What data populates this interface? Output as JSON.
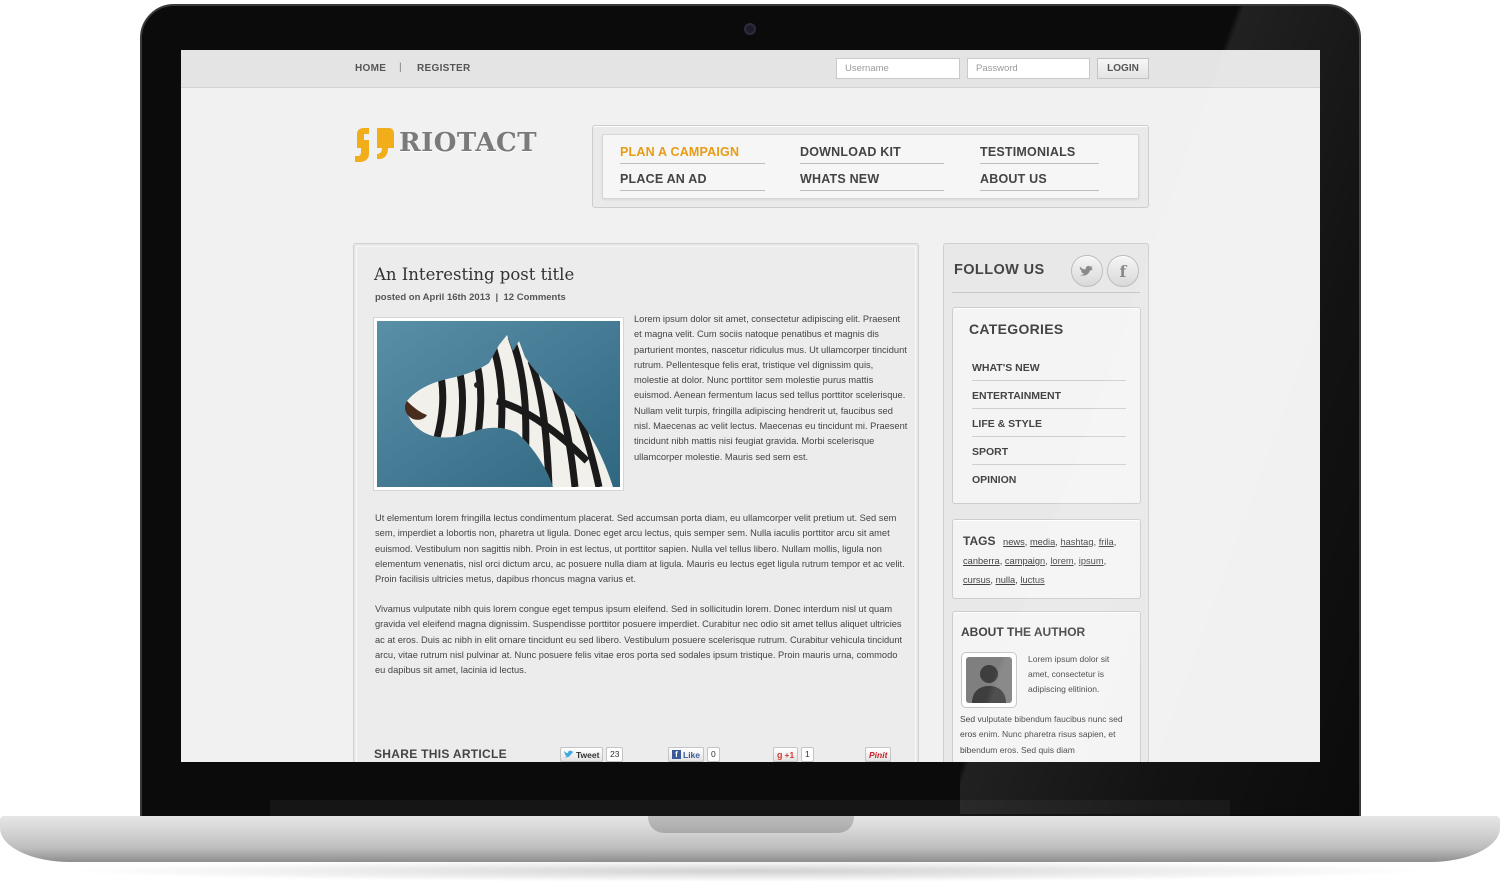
{
  "topbar": {
    "home": "HOME",
    "separator": "|",
    "register": "REGISTER",
    "username_placeholder": "Username",
    "password_placeholder": "Password",
    "login": "LOGIN"
  },
  "brand": {
    "name": "RIOTACT",
    "accent_color": "#f2ae1a"
  },
  "nav": {
    "items": [
      {
        "label": "PLAN A CAMPAIGN",
        "active": true
      },
      {
        "label": "DOWNLOAD KIT"
      },
      {
        "label": "TESTIMONIALS"
      },
      {
        "label": "PLACE AN AD"
      },
      {
        "label": "WHATS NEW"
      },
      {
        "label": "ABOUT US"
      }
    ],
    "active_color": "#e89b14"
  },
  "post": {
    "title": "An Interesting post title",
    "date": "posted on April 16th 2013",
    "meta_sep": "|",
    "comments": "12 Comments",
    "intro": "Lorem ipsum dolor sit amet, consectetur adipiscing elit. Praesent et magna velit. Cum sociis natoque penatibus et magnis dis parturient montes, nascetur ridiculus mus. Ut ullamcorper tincidunt rutrum. Pellentesque felis erat, tristique vel dignissim quis, molestie at dolor. Nunc porttitor sem molestie purus mattis euismod. Aenean fermentum lacus sed tellus porttitor scelerisque. Nullam velit turpis, fringilla adipiscing hendrerit ut, faucibus sed nisl. Maecenas ac velit lectus. Maecenas eu tincidunt mi. Praesent tincidunt nibh mattis nisi feugiat gravida. Morbi scelerisque ullamcorper molestie. Mauris sed sem est.",
    "para1": "Ut elementum lorem fringilla lectus condimentum placerat. Sed accumsan porta diam, eu ullamcorper velit pretium ut. Sed sem sem, imperdiet a lobortis non, pharetra ut ligula. Donec eget arcu lectus, quis semper sem. Nulla iaculis porttitor arcu sit amet euismod. Vestibulum non sagittis nibh. Proin in est lectus, ut porttitor sapien. Nulla vel tellus libero. Nullam mollis, ligula non elementum venenatis, nisl orci dictum arcu, ac posuere nulla diam at ligula. Mauris eu lectus eget ligula rutrum tempor et ac velit. Proin facilisis ultricies metus, dapibus rhoncus magna varius et.",
    "para2": "Vivamus vulputate nibh quis lorem congue eget tempus ipsum eleifend. Sed in sollicitudin lorem. Donec interdum nisl ut quam gravida vel eleifend magna dignissim. Suspendisse porttitor posuere imperdiet. Curabitur nec odio sit amet tellus aliquet ultricies ac at eros. Duis ac nibh in elit ornare tincidunt eu sed libero. Vestibulum posuere scelerisque rutrum. Curabitur vehicula tincidunt arcu, vitae rutrum nisl pulvinar at. Nunc posuere felis vitae eros porta sed sodales ipsum tristique. Proin mauris urna, commodo eu dapibus sit amet, lacinia id lectus."
  },
  "share": {
    "label": "SHARE THIS ARTICLE",
    "tweet": "Tweet",
    "tweet_count": "23",
    "like": "Like",
    "like_count": "0",
    "gplus": "+1",
    "gplus_count": "1",
    "pinit": "Pinit"
  },
  "sidebar": {
    "follow": "FOLLOW US",
    "social_icons": [
      "twitter-icon",
      "facebook-icon"
    ],
    "categories_title": "CATEGORIES",
    "categories": [
      "WHAT'S NEW",
      "ENTERTAINMENT",
      "LIFE & STYLE",
      "SPORT",
      "OPINION"
    ],
    "tags_title": "TAGS",
    "tags": [
      "news",
      "media",
      "hashtag",
      "frila",
      "canberra",
      "campaign",
      "lorem",
      "ipsum",
      "cursus",
      "nulla",
      "luctus"
    ],
    "author_title": "ABOUT THE AUTHOR",
    "author_short": "Lorem ipsum dolor sit amet, consectetur is adipiscing elitinion.",
    "author_long": "Sed vulputate bibendum faucibus nunc sed eros enim. Nunc pharetra risus sapien, et bibendum eros. Sed quis diam"
  }
}
